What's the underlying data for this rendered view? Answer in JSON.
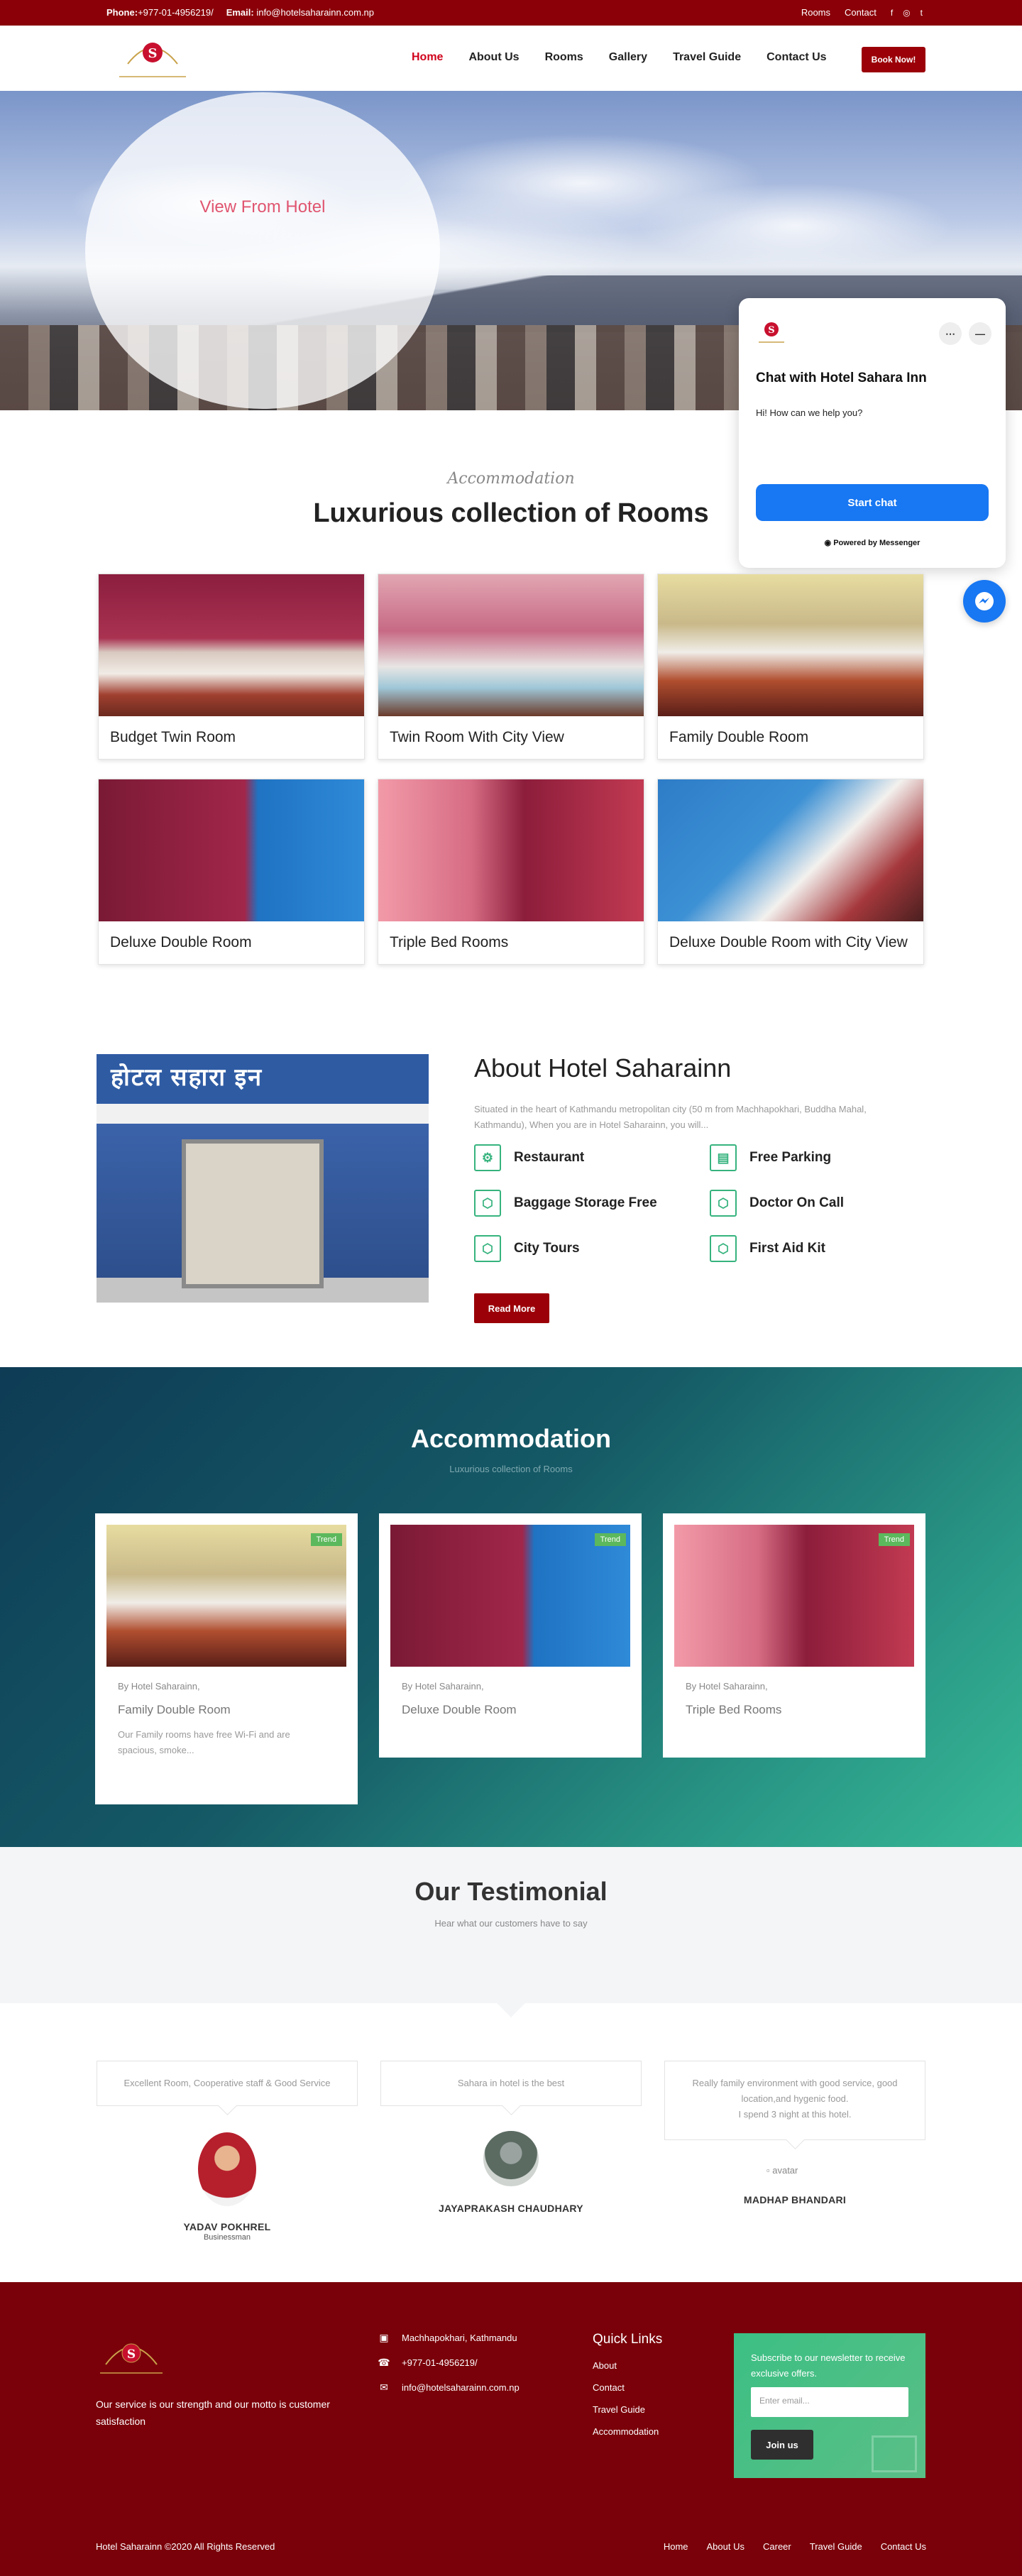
{
  "topbar": {
    "phone_label": "Phone:",
    "phone": "+977-01-4956219/",
    "email_label": "Email:",
    "email": "info@hotelsaharainn.com.np",
    "links": [
      "Rooms",
      "Contact"
    ],
    "social": [
      "f",
      "◎",
      "t"
    ]
  },
  "header": {
    "nav": [
      "Home",
      "About Us",
      "Rooms",
      "Gallery",
      "Travel Guide",
      "Contact Us"
    ],
    "book_label": "Book Now!"
  },
  "hero": {
    "title": "View From Hotel"
  },
  "chat": {
    "title": "Chat with Hotel Sahara Inn",
    "message": "Hi! How can we help you?",
    "start_label": "Start chat",
    "powered": "Powered by Messenger"
  },
  "rooms_section": {
    "eyebrow": "Accommodation",
    "title": "Luxurious collection of Rooms",
    "rooms": [
      "Budget Twin Room",
      "Twin Room With City View",
      "Family Double Room",
      "Deluxe Double Room",
      "Triple Bed Rooms",
      "Deluxe Double Room with City View"
    ]
  },
  "about": {
    "title": "About Hotel Saharainn",
    "text": "Situated in the heart of Kathmandu metropolitan city (50 m from Machhapokhari, Buddha Mahal, Kathmandu), When you are in Hotel Saharainn, you will...",
    "sign_text": "होटल सहारा इन",
    "amenities": [
      "Restaurant",
      "Free Parking",
      "Baggage Storage Free",
      "Doctor On Call",
      "City Tours",
      "First Aid Kit"
    ],
    "read_more": "Read More"
  },
  "accommodation": {
    "title": "Accommodation",
    "subtitle": "Luxurious collection of Rooms",
    "badge": "Trend",
    "cards": [
      {
        "by": "By Hotel Saharainn,",
        "title": "Family Double Room",
        "desc": "Our  Family rooms have free Wi-Fi and are spacious, smoke..."
      },
      {
        "by": "By Hotel Saharainn,",
        "title": "Deluxe Double Room",
        "desc": ""
      },
      {
        "by": "By Hotel Saharainn,",
        "title": "Triple Bed Rooms",
        "desc": ""
      }
    ]
  },
  "testimonial": {
    "title": "Our Testimonial",
    "subtitle": "Hear what our customers have to say",
    "items": [
      {
        "quote": "Excellent Room, Cooperative staff & Good Service",
        "name": "YADAV POKHREL",
        "role": "Businessman"
      },
      {
        "quote": "Sahara in hotel is the best",
        "name": "JAYAPRAKASH CHAUDHARY",
        "role": ""
      },
      {
        "quote_lines": [
          "Really family environment with good service, good location,and hygenic food.",
          "I spend 3 night at this hotel."
        ],
        "name": "MADHAP BHANDARI",
        "role": "",
        "avatar_alt": "avatar"
      }
    ]
  },
  "footer": {
    "about": "Our service is our strength and our motto is customer satisfaction",
    "address": "Machhapokhari, Kathmandu",
    "phone": "+977-01-4956219/",
    "email": "info@hotelsaharainn.com.np",
    "quick_title": "Quick Links",
    "quick_links": [
      "About",
      "Contact",
      "Travel Guide",
      "Accommodation"
    ],
    "newsletter_text": "Subscribe to our newsletter to receive exclusive offers.",
    "newsletter_placeholder": "Enter email...",
    "join_label": "Join us",
    "copyright": "Hotel Saharainn ©2020 All Rights Reserved",
    "bottom_links": [
      "Home",
      "About Us",
      "Career",
      "Travel Guide",
      "Contact Us"
    ]
  },
  "colors": {
    "brand": "#9b0008",
    "accent_green": "#36b37e",
    "messenger": "#1877f2"
  }
}
